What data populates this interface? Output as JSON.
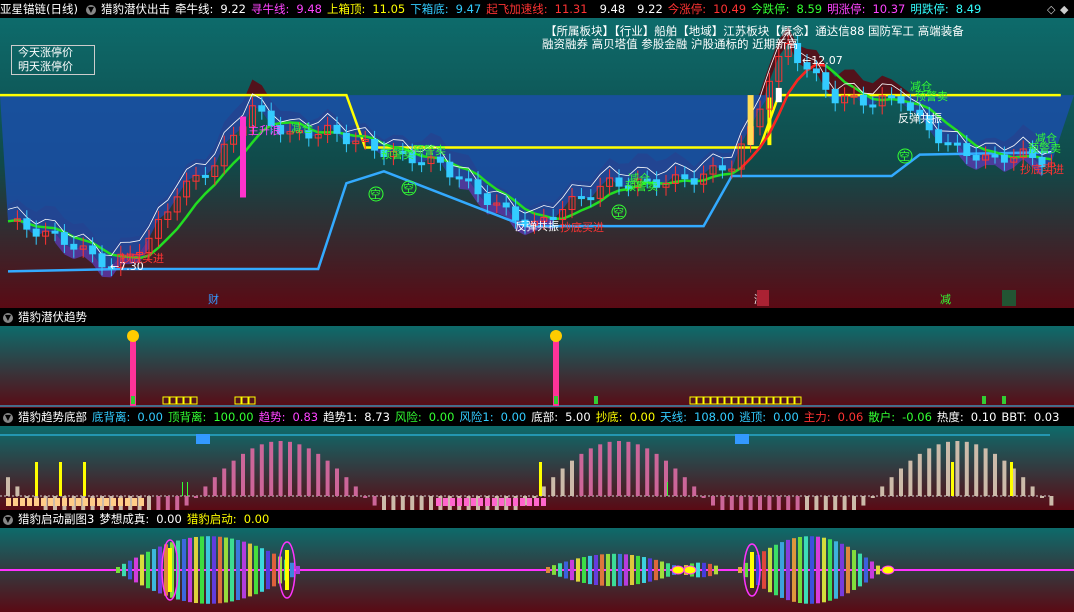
{
  "panels": {
    "main": {
      "stock": "亚星锚链",
      "period": "(日线)",
      "indicator": "猎豹潜伏出击",
      "legend": [
        {
          "label": "牵牛线:",
          "value": "9.22",
          "color": "#ffffff"
        },
        {
          "label": "寻牛线:",
          "value": "9.48",
          "color": "#ff44ff"
        },
        {
          "label": "上箱顶:",
          "value": "11.05",
          "color": "#ffff00"
        },
        {
          "label": "下箱底:",
          "value": "9.47",
          "color": "#33ccff"
        },
        {
          "label": "起飞加速线:",
          "value": "11.31",
          "color": "#ff3333"
        },
        {
          "label": "",
          "value": "9.48",
          "color": "#ffffff"
        },
        {
          "label": "",
          "value": "9.22",
          "color": "#ffffff"
        },
        {
          "label": "今涨停:",
          "value": "10.49",
          "color": "#ff3333"
        },
        {
          "label": "今跌停:",
          "value": "8.59",
          "color": "#33ff33"
        },
        {
          "label": "明涨停:",
          "value": "10.37",
          "color": "#ff44ff"
        },
        {
          "label": "明跌停:",
          "value": "8.49",
          "color": "#33ffff"
        }
      ],
      "badge_line1": "今天涨停价",
      "badge_line2": "明天涨停价",
      "concepts_line1": "【所属板块】【行业】船舶【地域】江苏板块【概念】通达信88 国防军工 高端装备",
      "concepts_line2": "融资融券 高贝塔值 参股金融 沪股通标的 近期新高",
      "high_label": "12.07",
      "low_label": "7.30",
      "annotations": [
        "主升浪",
        "减仓",
        "减仓",
        "预警卖",
        "预警卖",
        "减仓",
        "预警卖",
        "减仓",
        "预警卖",
        "减仓",
        "预警卖",
        "反弹共振",
        "反弹共振",
        "抄底买进",
        "抄底买进",
        "抄底买进",
        "空",
        "空",
        "空",
        "空"
      ],
      "bottom_markers": [
        "财",
        "涨",
        "减",
        "港"
      ],
      "corner_glyphs": [
        "◇",
        "◆"
      ]
    },
    "trend": {
      "title": "猎豹潜伏趋势"
    },
    "bottom": {
      "title": "猎豹趋势底部",
      "legend": [
        {
          "label": "底背离:",
          "value": "0.00",
          "color": "#33ccff"
        },
        {
          "label": "顶背离:",
          "value": "100.00",
          "color": "#33ff33"
        },
        {
          "label": "趋势:",
          "value": "0.83",
          "color": "#ff44ff"
        },
        {
          "label": "趋势1:",
          "value": "8.73",
          "color": "#ffffff"
        },
        {
          "label": "风险:",
          "value": "0.00",
          "color": "#33ff33"
        },
        {
          "label": "风险1:",
          "value": "0.00",
          "color": "#33ccff"
        },
        {
          "label": "底部:",
          "value": "5.00",
          "color": "#ffffff"
        },
        {
          "label": "抄底:",
          "value": "0.00",
          "color": "#ffff00"
        },
        {
          "label": "天线:",
          "value": "108.00",
          "color": "#33ccff"
        },
        {
          "label": "逃顶:",
          "value": "0.00",
          "color": "#33ccff"
        },
        {
          "label": "主力:",
          "value": "0.06",
          "color": "#ff3333"
        },
        {
          "label": "散户:",
          "value": "-0.06",
          "color": "#33ff33"
        },
        {
          "label": "热度:",
          "value": "0.10",
          "color": "#ffffff"
        },
        {
          "label": "BBT:",
          "value": "0.03",
          "color": "#ffffff"
        }
      ]
    },
    "start": {
      "title": "猎豹启动副图3",
      "legend": [
        {
          "label": "梦想成真:",
          "value": "0.00",
          "color": "#ffffff"
        },
        {
          "label": "猎豹启动:",
          "value": "0.00",
          "color": "#ffff00"
        }
      ]
    }
  },
  "chart_data": [
    {
      "type": "candlestick",
      "ylim": [
        7.0,
        12.5
      ],
      "high": "12.07",
      "low": "7.30",
      "upper_box": 11.05,
      "lower_box": 9.47
    },
    {
      "type": "bar",
      "label": "猎豹潜伏趋势"
    },
    {
      "type": "bar",
      "label": "猎豹趋势底部"
    },
    {
      "type": "bar",
      "label": "猎豹启动副图3"
    }
  ],
  "colors": {
    "up": "#ff3333",
    "down": "#33ccff",
    "box": "#ffff00",
    "support": "#33aaff",
    "mid": "#22dd22"
  }
}
